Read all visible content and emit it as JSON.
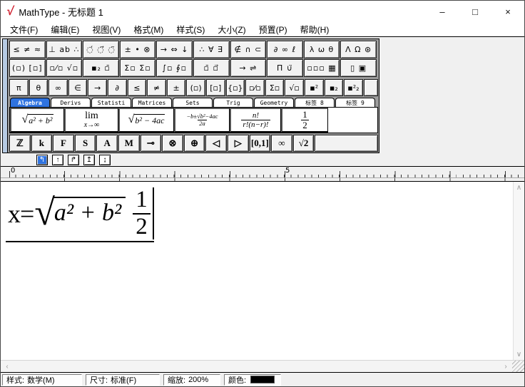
{
  "window": {
    "logo_glyph": "√",
    "title": "MathType - 无标题 1",
    "minimize": "–",
    "maximize": "□",
    "close": "×"
  },
  "menus": [
    "文件(F)",
    "编辑(E)",
    "视图(V)",
    "格式(M)",
    "样式(S)",
    "大小(Z)",
    "预置(P)",
    "帮助(H)"
  ],
  "toolbar": {
    "palette_row1": [
      "≤ ≠ ≈",
      "⊥ ab ∴",
      "◌́ ◌⃗ ◌̈",
      "± • ⊗",
      "→ ⇔ ↓",
      "∴ ∀ ∃",
      "∉ ∩ ⊂",
      "∂ ∞ ℓ",
      "λ ω θ",
      "Λ Ω ⊛"
    ],
    "palette_row2": [
      "(▫) [▫]",
      "▫⁄▫ √▫",
      "▪₂ ▫̄",
      "Σ▫ Σ▫",
      "∫▫ ∮▫",
      "▫̄ ▫⃗",
      "→ ⇌",
      "Π̈ ∪̈",
      "▫▫▫ ▦",
      "▯ ▣"
    ],
    "small_bar": [
      "π",
      "θ",
      "∞",
      "∈",
      "→",
      "∂",
      "≤",
      "≠",
      "±",
      "(▫)",
      "[▫]",
      "{▫}",
      "▫⁄▫",
      "Σ▫",
      "√▫",
      "▪²",
      "▪₂",
      "▪²₂"
    ],
    "tabs": [
      "Algebra",
      "Derivs",
      "Statisti",
      "Matrices",
      "Sets",
      "Trig",
      "Geometry",
      "标签 8",
      "标签 9"
    ],
    "templates": {
      "t1": {
        "sqrt": "√",
        "body": "a² + b²"
      },
      "t2": {
        "top": "lim",
        "bottom": "x→∞"
      },
      "t3": {
        "sqrt": "√",
        "body": "b² − 4ac"
      },
      "t4": {
        "num": "−b±√b²−4ac",
        "den": "2a"
      },
      "t5": {
        "num": "n!",
        "den": "r!(n−r)!"
      },
      "t6": {
        "num": "1",
        "den": "2"
      }
    },
    "letters": [
      "ℤ",
      "k",
      "F",
      "S",
      "A",
      "M",
      "⊸",
      "⊗",
      "⊕",
      "◁",
      "▷",
      "[0,1]",
      "∞",
      "√2"
    ]
  },
  "ruler": {
    "tabstop_icons": [
      "↰",
      "↑",
      "↱",
      "↥",
      "↨"
    ],
    "label_start": "0",
    "label_mid": "5"
  },
  "equation": {
    "lhs": "x=",
    "sqrt_glyph": "√",
    "radicand": "a² + b²",
    "frac_num": "1",
    "frac_den": "2"
  },
  "scrollbars": {
    "up": "∧",
    "down": "∨",
    "left": "‹",
    "right": "›"
  },
  "status": {
    "style_label": "样式:",
    "style_value": "数学(M)",
    "size_label": "尺寸:",
    "size_value": "标准(F)",
    "zoom_label": "缩放:",
    "zoom_value": "200%",
    "color_label": "颜色:"
  },
  "colors": {
    "accent_blue": "#2f73e0",
    "handle_blue": "#b7cbe3",
    "logo_red": "#d01f2e",
    "color_swatch": "#000000"
  }
}
